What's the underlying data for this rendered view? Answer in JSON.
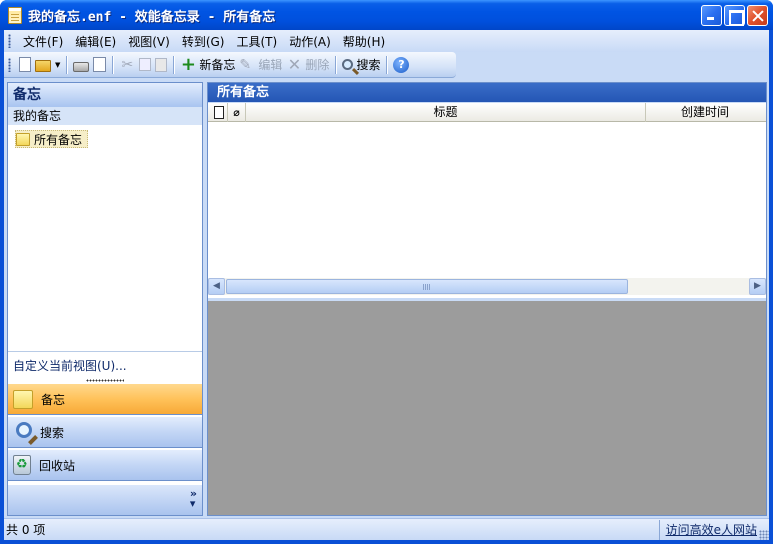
{
  "window": {
    "title": "我的备忘.enf - 效能备忘录 - 所有备忘"
  },
  "menu": {
    "items": [
      "文件(F)",
      "编辑(E)",
      "视图(V)",
      "转到(G)",
      "工具(T)",
      "动作(A)",
      "帮助(H)"
    ]
  },
  "toolbar": {
    "new_note": "新备忘",
    "edit": "编辑",
    "delete": "删除",
    "search": "搜索"
  },
  "left_pane": {
    "header": "备忘",
    "section": "我的备忘",
    "tree_item": "所有备忘",
    "customize": "自定义当前视图(U)...",
    "nav": {
      "notes": "备忘",
      "search": "搜索",
      "recycle": "回收站"
    }
  },
  "right_pane": {
    "header": "所有备忘",
    "columns": {
      "title": "标题",
      "created": "创建时间"
    }
  },
  "status": {
    "count": "共 0 项",
    "link": "访问高效e人网站"
  },
  "colors": {
    "title_bar": "#0054e3",
    "active_nav": "#ffc25a",
    "preview_bg": "#9c9c9c"
  }
}
